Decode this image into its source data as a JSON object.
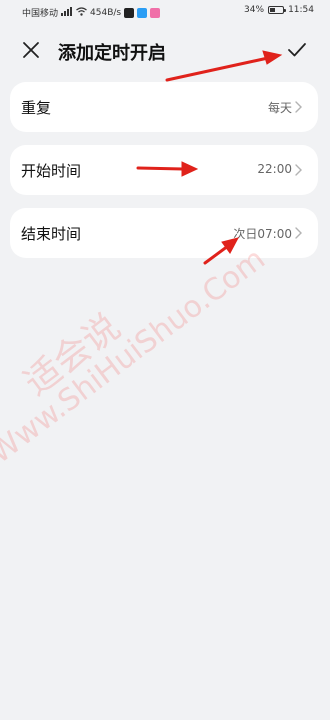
{
  "status_bar": {
    "carrier": "中国移动",
    "net_speed": "454B/s",
    "battery": "34%",
    "time": "11:54"
  },
  "header": {
    "title": "添加定时开启"
  },
  "rows": [
    {
      "label": "重复",
      "value": "每天"
    },
    {
      "label": "开始时间",
      "value": "22:00"
    },
    {
      "label": "结束时间",
      "value": "次日07:00"
    }
  ],
  "watermark": {
    "cn": "适会说",
    "en": "Www.ShiHuiShuo.Com"
  },
  "colors": {
    "background": "#f1f2f4",
    "card": "#ffffff",
    "annotation_arrow": "#e0221b"
  }
}
